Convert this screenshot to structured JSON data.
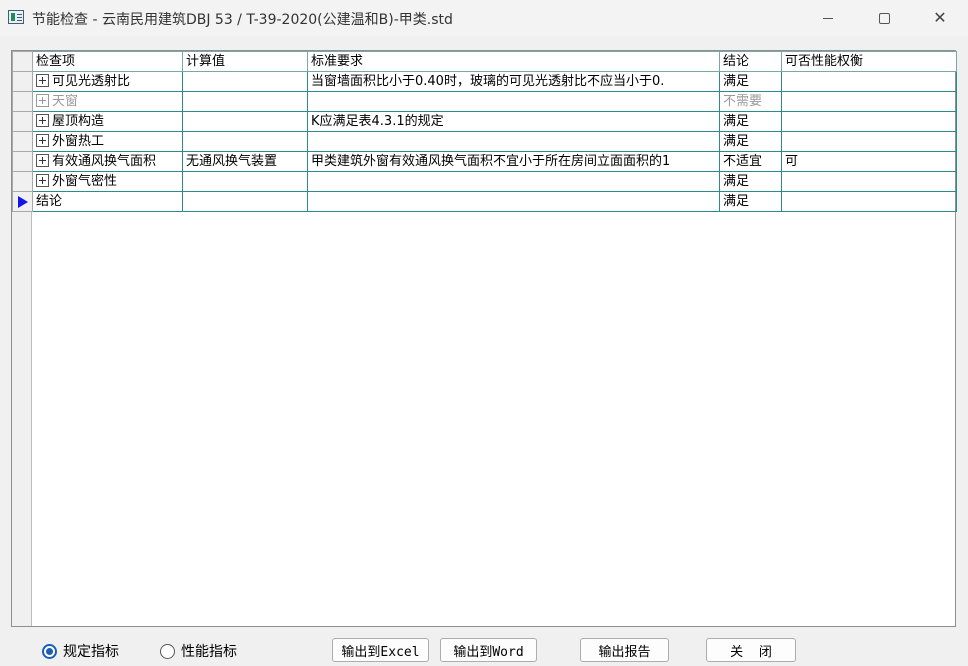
{
  "window": {
    "title": "节能检查 - 云南民用建筑DBJ 53 / T-39-2020(公建温和B)-甲类.std"
  },
  "table": {
    "columns": [
      "检查项",
      "计算值",
      "标准要求",
      "结论",
      "可否性能权衡"
    ],
    "rows": [
      {
        "item": "可见光透射比",
        "value": "",
        "requirement": "当窗墙面积比小于0.40时，玻璃的可见光透射比不应当小于0.",
        "result": "满足",
        "tradeoff": "",
        "expandable": true,
        "disabled": false
      },
      {
        "item": "天窗",
        "value": "",
        "requirement": "",
        "result": "不需要",
        "tradeoff": "",
        "expandable": true,
        "disabled": true
      },
      {
        "item": "屋顶构造",
        "value": "",
        "requirement": "K应满足表4.3.1的规定",
        "result": "满足",
        "tradeoff": "",
        "expandable": true,
        "disabled": false
      },
      {
        "item": "外窗热工",
        "value": "",
        "requirement": "",
        "result": "满足",
        "tradeoff": "",
        "expandable": true,
        "disabled": false
      },
      {
        "item": "有效通风换气面积",
        "value": "无通风换气装置",
        "requirement": "甲类建筑外窗有效通风换气面积不宜小于所在房间立面面积的1",
        "result": "不适宜",
        "tradeoff": "可",
        "expandable": true,
        "disabled": false
      },
      {
        "item": "外窗气密性",
        "value": "",
        "requirement": "",
        "result": "满足",
        "tradeoff": "",
        "expandable": true,
        "disabled": false
      },
      {
        "item": "结论",
        "value": "",
        "requirement": "",
        "result": "满足",
        "tradeoff": "",
        "expandable": false,
        "disabled": false,
        "current": true
      }
    ]
  },
  "footer": {
    "radio_options": [
      {
        "label": "规定指标",
        "selected": true
      },
      {
        "label": "性能指标",
        "selected": false
      }
    ],
    "buttons": {
      "excel": "输出到Excel",
      "word": "输出到Word",
      "report": "输出报告",
      "close": "关  闭"
    }
  },
  "colors": {
    "grid_line": "#2e8b8b",
    "current_row_arrow": "#1414e6",
    "radio_accent": "#1a5fb4",
    "disabled_text": "#9a9a9a"
  }
}
